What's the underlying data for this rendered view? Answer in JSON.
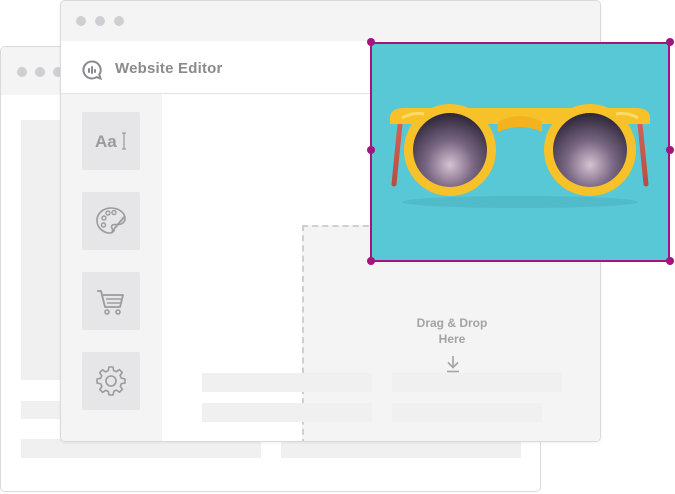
{
  "app": {
    "title": "Website Editor",
    "logo_icon": "chat-bubble-logo-icon"
  },
  "dropzone": {
    "line1": "Drag & Drop",
    "line2": "Here",
    "icon": "download-arrow-icon"
  },
  "tools": [
    {
      "name": "text-tool",
      "icon": "text-style-icon",
      "glyph": "Aa"
    },
    {
      "name": "theme-tool",
      "icon": "palette-icon"
    },
    {
      "name": "store-tool",
      "icon": "cart-icon"
    },
    {
      "name": "settings-tool",
      "icon": "gear-icon"
    }
  ],
  "image": {
    "subject": "yellow sunglasses",
    "background_color": "#58c7d6",
    "frame_color": "#a3147f",
    "icon": "sunglasses-image"
  },
  "colors": {
    "window_border": "#d9d9db",
    "panel_gray": "#f4f4f5",
    "tile_gray": "#e6e6e8",
    "text_gray": "#8a8a8f"
  }
}
